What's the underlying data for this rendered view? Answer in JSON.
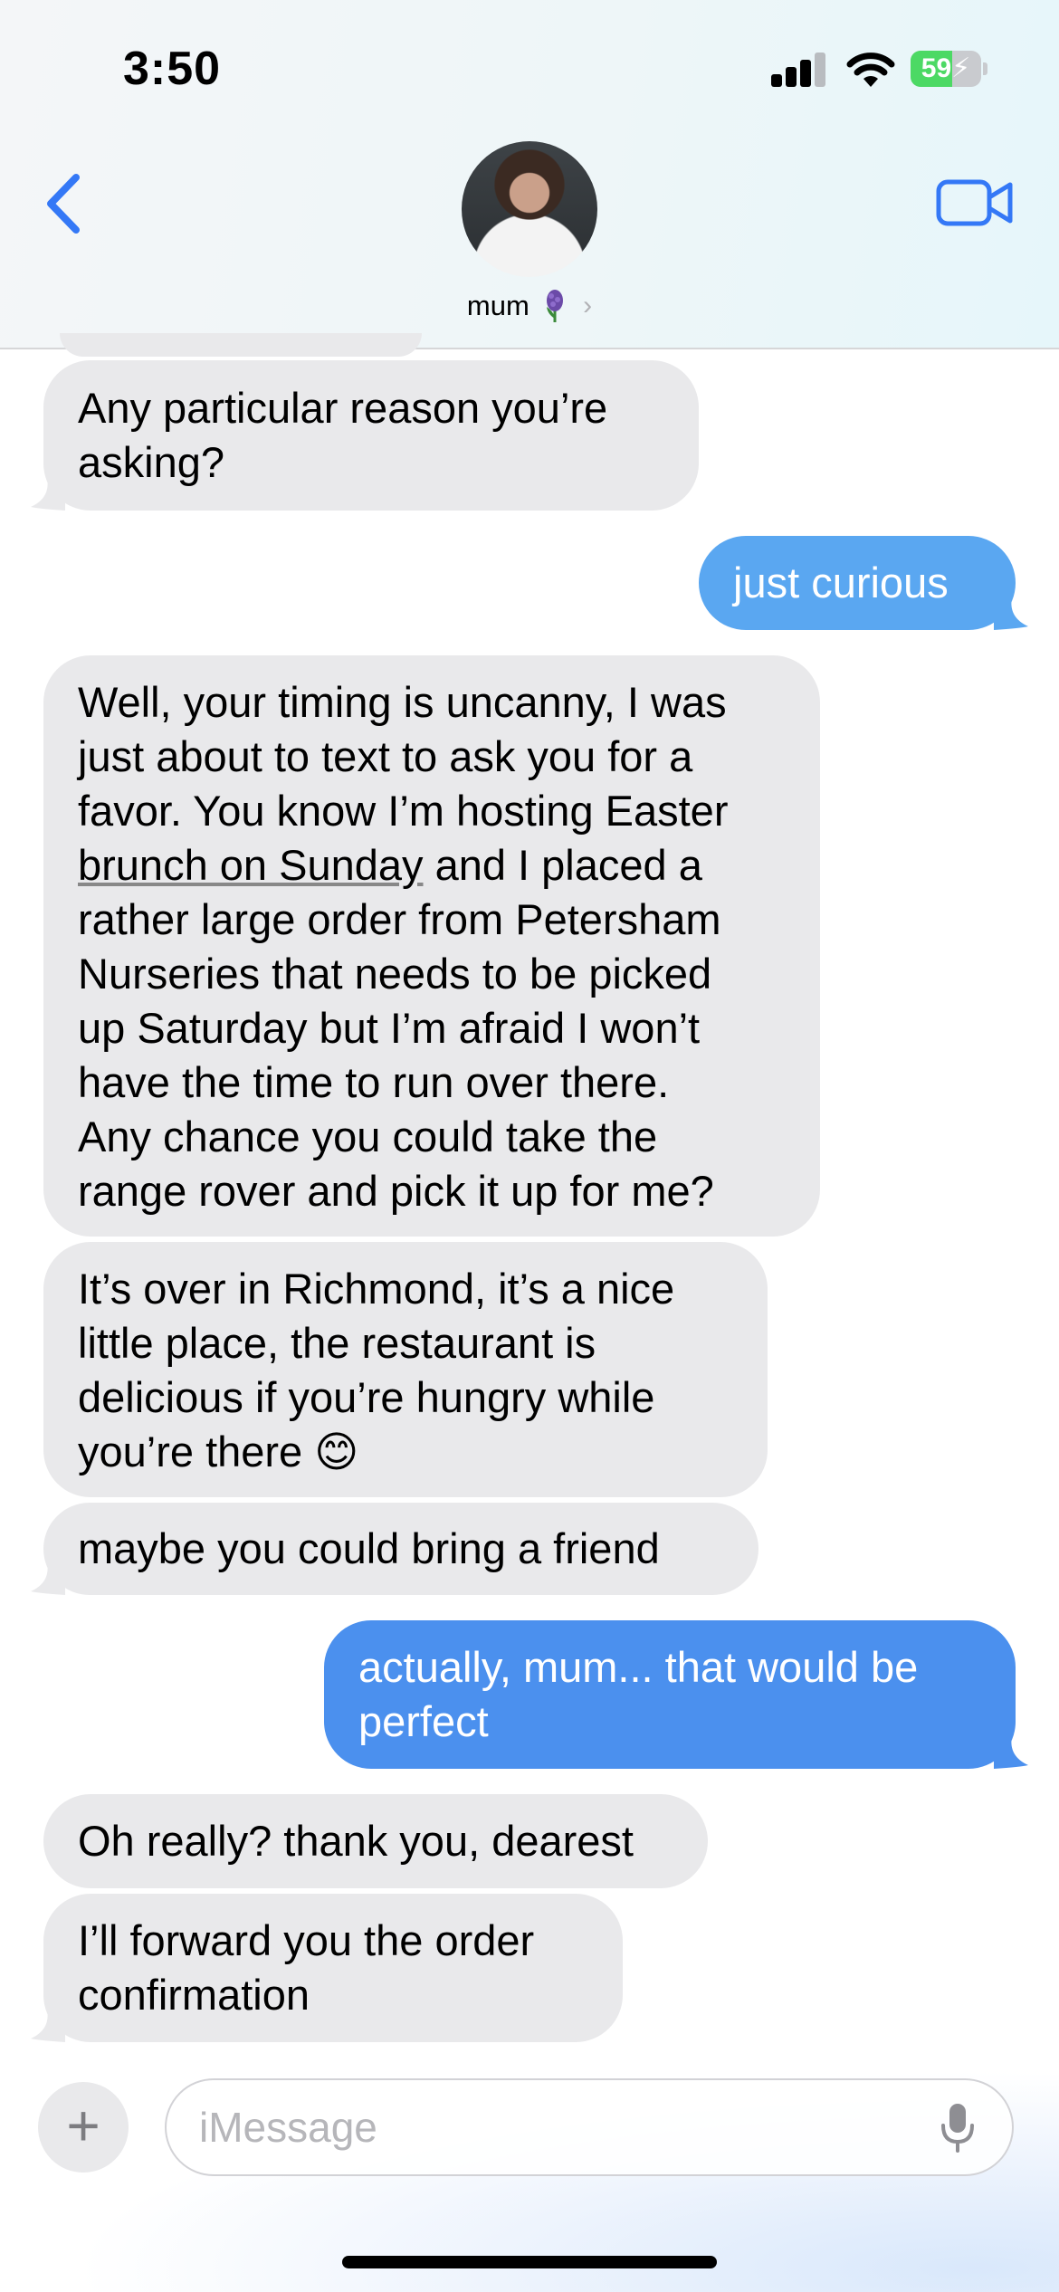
{
  "status_bar": {
    "time": "3:50",
    "battery": "59",
    "battery_level": 0.59,
    "cellular_bars_active": 3,
    "cellular_bars_total": 4
  },
  "header": {
    "contact_name": "mum",
    "contact_emoji_icon": "hyacinth-flower-icon",
    "back_icon": "chevron-left-icon",
    "video_icon": "video-camera-icon"
  },
  "messages": [
    {
      "from": "them",
      "lines": [
        "Any particular reason you’re",
        "asking?"
      ]
    },
    {
      "from": "me",
      "lines": [
        "just curious"
      ]
    },
    {
      "from": "them",
      "lines": [
        "Well, your timing is uncanny, I was",
        "just about to text to ask you for a",
        "favor. You know I’m hosting Easter",
        "brunch on Sunday and I placed a",
        "rather large order from Petersham",
        "Nurseries that needs to be picked",
        "up Saturday but I’m afraid I won’t",
        "have the time to run over there.",
        "Any chance you could take the",
        "range rover and pick it up for me?"
      ],
      "underlined": "brunch on Sunday"
    },
    {
      "from": "them",
      "lines": [
        "It’s over in Richmond, it’s a nice",
        "little place, the restaurant is",
        "delicious if you’re hungry while",
        "you’re there 😊"
      ]
    },
    {
      "from": "them",
      "lines": [
        "maybe you could bring a friend"
      ]
    },
    {
      "from": "me",
      "lines": [
        "actually, mum... that would be",
        "perfect"
      ]
    },
    {
      "from": "them",
      "lines": [
        "Oh really? thank you, dearest"
      ]
    },
    {
      "from": "them",
      "lines": [
        "I’ll forward you the order",
        "confirmation"
      ]
    }
  ],
  "composer": {
    "placeholder": "iMessage",
    "plus_label": "+",
    "plus_icon": "plus-icon",
    "mic_icon": "microphone-icon"
  },
  "colors": {
    "incoming_bubble": "#e9e9eb",
    "outgoing_bubble": "#4b90ee",
    "accent": "#3478f6"
  }
}
